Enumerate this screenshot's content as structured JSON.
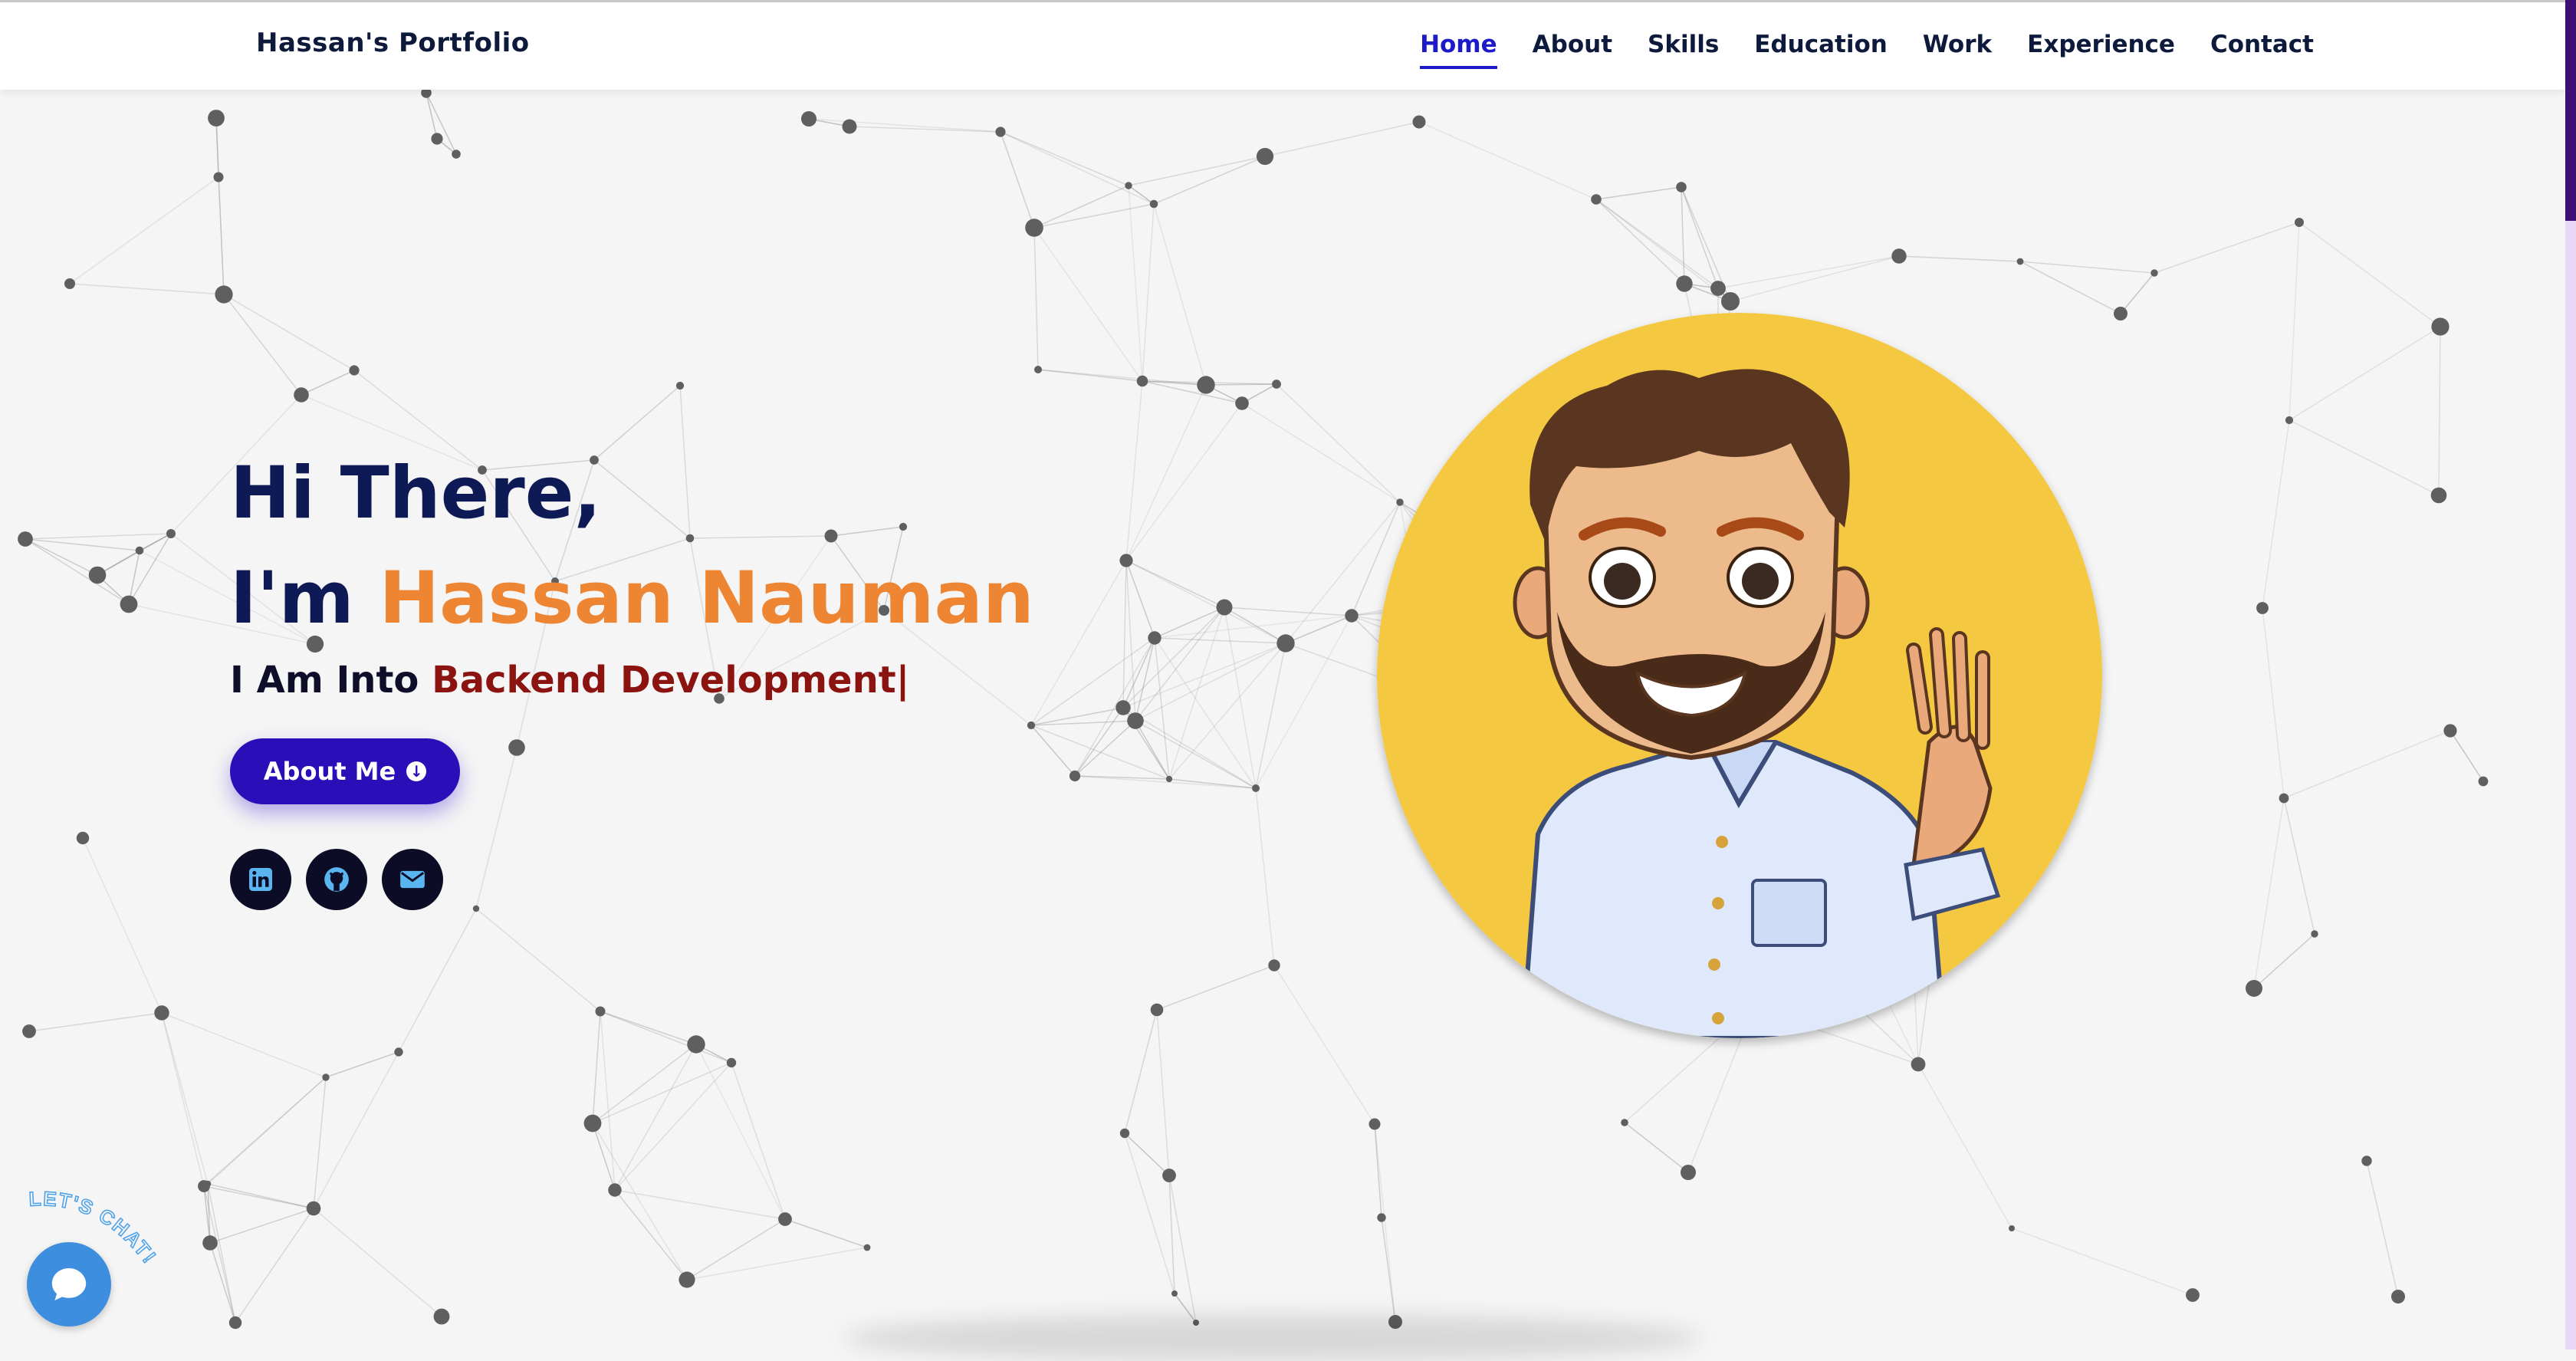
{
  "nav": {
    "brand": "Hassan's Portfolio",
    "items": [
      {
        "label": "Home",
        "active": true
      },
      {
        "label": "About"
      },
      {
        "label": "Skills"
      },
      {
        "label": "Education"
      },
      {
        "label": "Work"
      },
      {
        "label": "Experience"
      },
      {
        "label": "Contact"
      }
    ]
  },
  "hero": {
    "greeting": "Hi There,",
    "intro_prefix": "I'm ",
    "name": "Hassan Nauman",
    "typed_prefix": "I Am Into ",
    "typed_role": "Backend Development|",
    "about_button": "About Me",
    "socials": [
      "linkedin-icon",
      "github-icon",
      "envelope-icon"
    ]
  },
  "chat_widget": {
    "label": "LET'S CHAT!"
  },
  "colors": {
    "accent": "#2a0fb8",
    "nav_active": "#1d1ac8",
    "name_orange": "#ee8532",
    "role_red": "#8b1410",
    "heading_navy": "#0e1a56",
    "avatar_bg": "#f5c842",
    "chat_blue": "#3e8ee0"
  }
}
